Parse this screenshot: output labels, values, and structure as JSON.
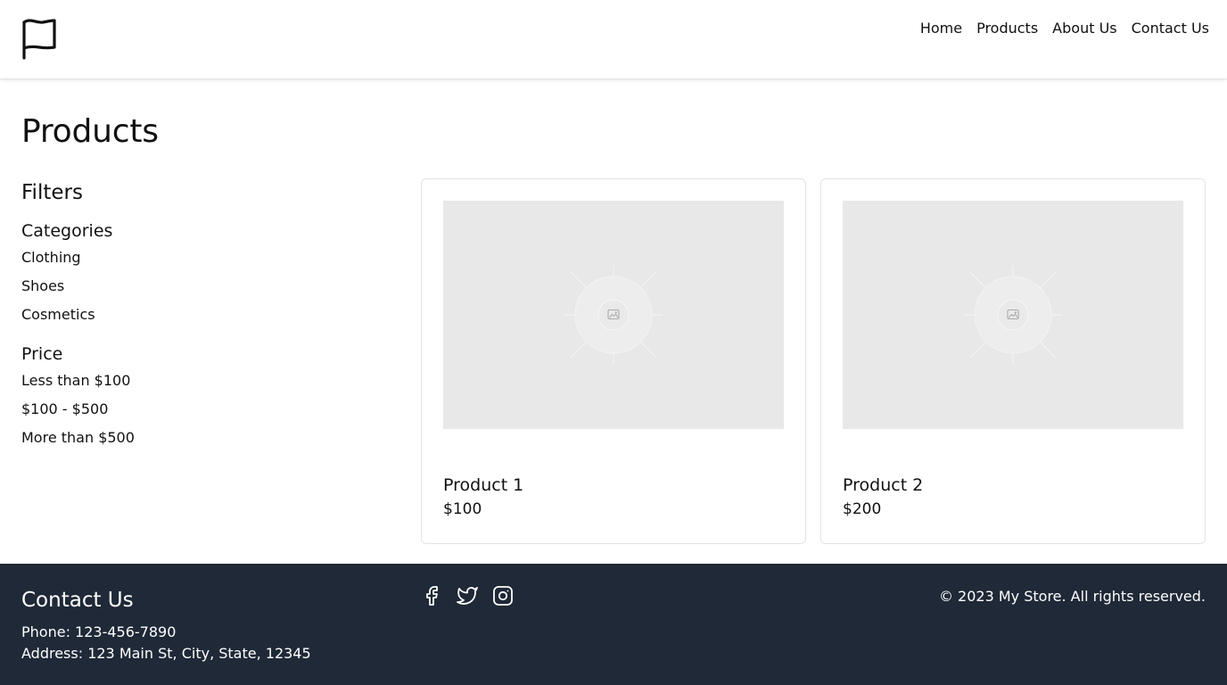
{
  "header": {
    "logo_icon": "flag-icon",
    "nav": [
      "Home",
      "Products",
      "About Us",
      "Contact Us"
    ]
  },
  "page": {
    "title": "Products"
  },
  "filters": {
    "title": "Filters",
    "categories": {
      "title": "Categories",
      "items": [
        "Clothing",
        "Shoes",
        "Cosmetics"
      ]
    },
    "price": {
      "title": "Price",
      "items": [
        "Less than $100",
        "$100 - $500",
        "More than $500"
      ]
    }
  },
  "products": [
    {
      "name": "Product 1",
      "price": "$100",
      "image_icon": "image-placeholder-icon"
    },
    {
      "name": "Product 2",
      "price": "$200",
      "image_icon": "image-placeholder-icon"
    }
  ],
  "footer": {
    "title": "Contact Us",
    "phone": "Phone: 123-456-7890",
    "address": "Address: 123 Main St, City, State, 12345",
    "social_icons": [
      "facebook-icon",
      "twitter-icon",
      "instagram-icon"
    ],
    "copyright": "© 2023 My Store. All rights reserved."
  },
  "colors": {
    "footer_bg": "#1f2937",
    "image_placeholder": "#e8e8e8",
    "card_border": "#e3e3e3"
  }
}
